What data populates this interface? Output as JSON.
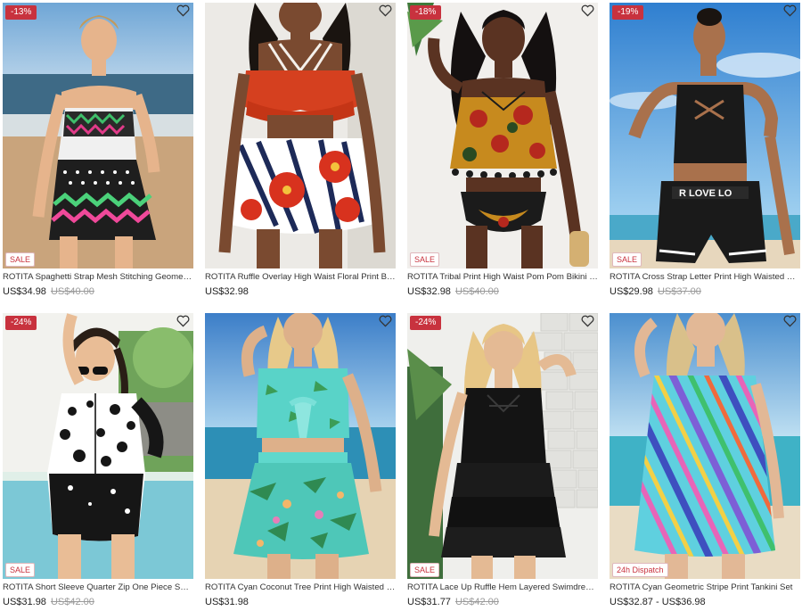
{
  "products": [
    {
      "title": "ROTITA Spaghetti Strap Mesh Stitching Geometric Pri...",
      "price": "US$34.98",
      "original_price": "US$40.00",
      "discount": "-13%",
      "tag": "SALE"
    },
    {
      "title": "ROTITA Ruffle Overlay High Waist Floral Print Bikini Set",
      "price": "US$32.98",
      "original_price": "",
      "discount": "",
      "tag": ""
    },
    {
      "title": "ROTITA Tribal Print High Waist Pom Pom Bikini Set",
      "price": "US$32.98",
      "original_price": "US$40.00",
      "discount": "-18%",
      "tag": "SALE"
    },
    {
      "title": "ROTITA Cross Strap Letter Print High Waisted Bikini Set",
      "price": "US$29.98",
      "original_price": "US$37.00",
      "discount": "-19%",
      "tag": "SALE"
    },
    {
      "title": "ROTITA Short Sleeve Quarter Zip One Piece Swimwear",
      "price": "US$31.98",
      "original_price": "US$42.00",
      "discount": "-24%",
      "tag": "SALE"
    },
    {
      "title": "ROTITA Cyan Coconut Tree Print High Waisted Bikini Set",
      "price": "US$31.98",
      "original_price": "",
      "discount": "",
      "tag": ""
    },
    {
      "title": "ROTITA Lace Up Ruffle Hem Layered Swimdress and P...",
      "price": "US$31.77",
      "original_price": "US$42.00",
      "discount": "-24%",
      "tag": "SALE"
    },
    {
      "title": "ROTITA Cyan Geometric Stripe Print Tankini Set",
      "price": "US$32.87 - US$36.98",
      "original_price": "",
      "discount": "",
      "tag": "24h Dispatch"
    }
  ],
  "icons": {
    "wishlist": "heart-outline-icon"
  },
  "colors": {
    "accent": "#c8323e",
    "strike_price": "#9a9a9a"
  }
}
